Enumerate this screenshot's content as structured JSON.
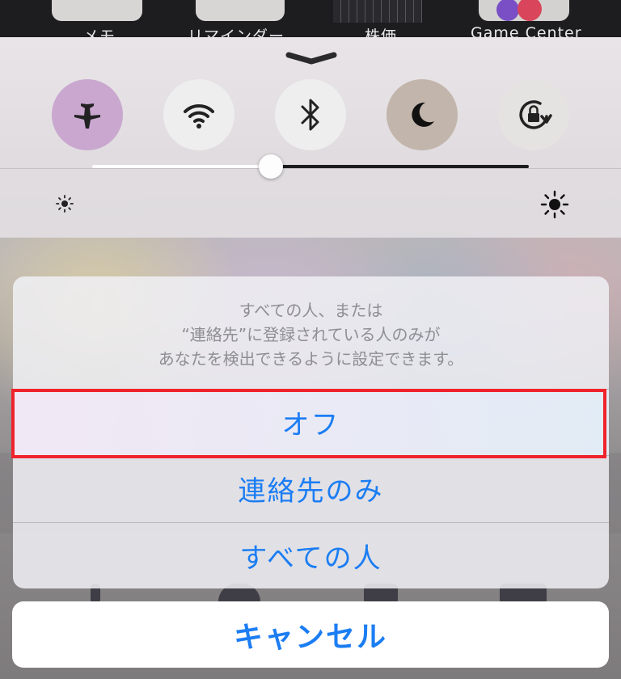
{
  "home_screen": {
    "labels": [
      "メモ",
      "リマインダー",
      "株価",
      "Game Center"
    ]
  },
  "control_center": {
    "toggles": [
      {
        "name": "airplane-mode",
        "icon": "airplane-icon",
        "state": "on"
      },
      {
        "name": "wifi",
        "icon": "wifi-icon",
        "state": "on"
      },
      {
        "name": "bluetooth",
        "icon": "bluetooth-icon",
        "state": "on"
      },
      {
        "name": "do-not-disturb",
        "icon": "moon-icon",
        "state": "off"
      },
      {
        "name": "rotation-lock",
        "icon": "rotation-lock-icon",
        "state": "on"
      }
    ],
    "brightness": {
      "level": 0.41
    }
  },
  "action_sheet": {
    "message_lines": [
      "すべての人、または",
      "“連絡先”に登録されている人のみが",
      "あなたを検出できるように設定できます。"
    ],
    "options": [
      {
        "label": "オフ",
        "highlighted": true
      },
      {
        "label": "連絡先のみ",
        "highlighted": false
      },
      {
        "label": "すべての人",
        "highlighted": false
      }
    ],
    "cancel_label": "キャンセル"
  },
  "colors": {
    "action_blue": "#1B7DF3",
    "highlight_red": "#F0222B",
    "message_gray": "#8E8E93"
  }
}
